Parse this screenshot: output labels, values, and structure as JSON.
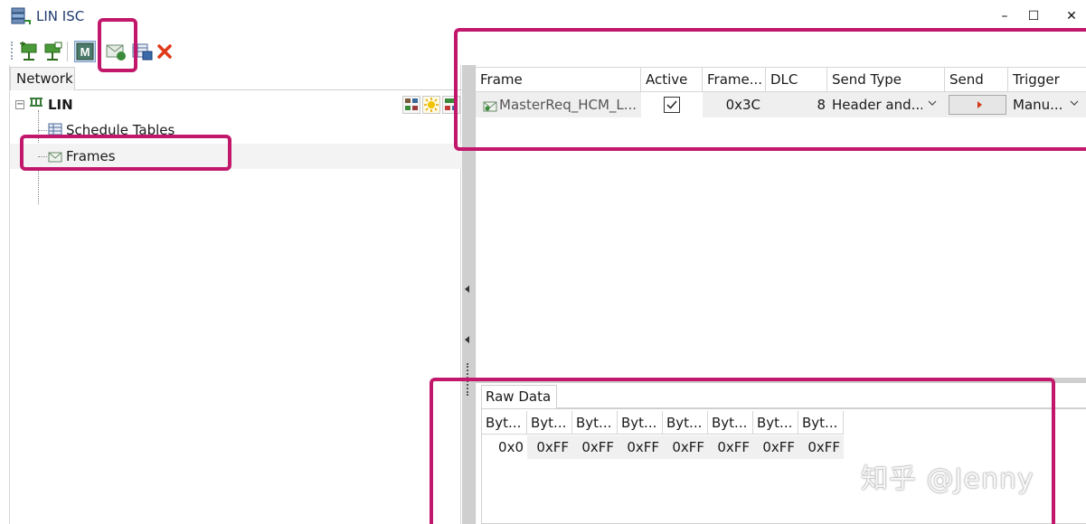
{
  "window": {
    "title": "LIN ISC",
    "minimize": "–",
    "maximize": "☐",
    "close": "✕"
  },
  "left": {
    "tab_label": "Network",
    "tree": {
      "root": "LIN",
      "children": [
        "Schedule Tables",
        "Frames"
      ]
    }
  },
  "frames_grid": {
    "headers": [
      "Frame",
      "Active",
      "Frame...",
      "DLC",
      "Send Type",
      "Send",
      "Trigger"
    ],
    "rows": [
      {
        "frame": "MasterReq_HCM_L...",
        "active": true,
        "frame_id": "0x3C",
        "dlc": "8",
        "send_type": "Header and...",
        "trigger": "Manu..."
      }
    ]
  },
  "raw_data": {
    "tab_label": "Raw Data",
    "headers": [
      "Byt...",
      "Byt...",
      "Byt...",
      "Byt...",
      "Byt...",
      "Byt...",
      "Byt...",
      "Byt..."
    ],
    "values": [
      "0x0",
      "0xFF",
      "0xFF",
      "0xFF",
      "0xFF",
      "0xFF",
      "0xFF",
      "0xFF"
    ]
  },
  "watermark": "知乎 @Jenny",
  "colors": {
    "highlight": "#c2186b",
    "send_arrow": "#d43a1a"
  }
}
